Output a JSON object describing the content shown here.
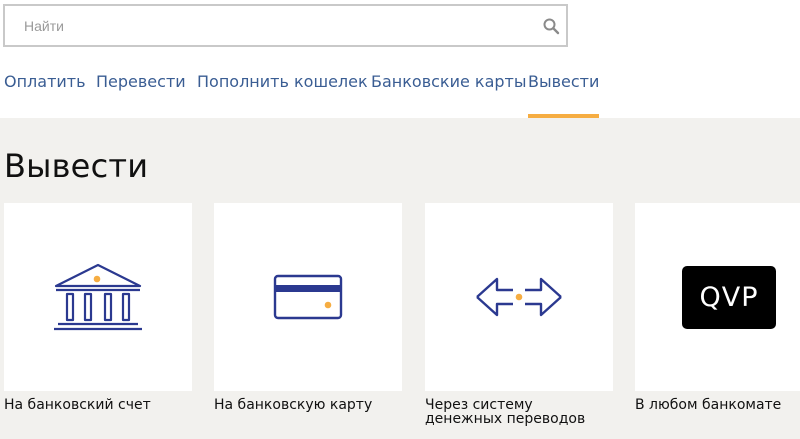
{
  "search": {
    "placeholder": "Найти"
  },
  "nav": {
    "items": [
      {
        "label": "Оплатить"
      },
      {
        "label": "Перевести"
      },
      {
        "label": "Пополнить кошелек"
      },
      {
        "label": "Банковские карты"
      },
      {
        "label": "Вывести"
      }
    ],
    "active_index": 4
  },
  "page": {
    "title": "Вывести"
  },
  "cards": [
    {
      "label": "На банковский счет",
      "icon": "bank-icon"
    },
    {
      "label": "На банковскую карту",
      "icon": "credit-card-icon"
    },
    {
      "label": "Через систему денежных переводов",
      "icon": "transfer-arrows-icon"
    },
    {
      "label": "В любом банкомате",
      "icon": "qvp-logo",
      "badge_text": "QVP"
    }
  ],
  "colors": {
    "accent": "#f6ad42",
    "nav_text": "#3a5d93",
    "icon_stroke": "#2b3990",
    "background": "#f2f1ee"
  }
}
